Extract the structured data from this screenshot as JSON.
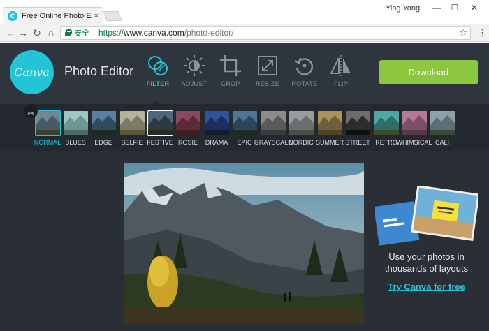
{
  "browser": {
    "tab_title": "Free Online Photo Editor",
    "tab_close": "×",
    "favicon_letter": "C",
    "user_name": "Ying Yong",
    "window_minimize": "—",
    "window_maximize": "☐",
    "window_close": "✕",
    "secure_label": "安全",
    "url_scheme": "https://",
    "url_host": "www.canva.com",
    "url_path": "/photo-editor/"
  },
  "app": {
    "logo_text": "Canva",
    "title": "Photo Editor",
    "download_label": "Download",
    "accent_color": "#23c4d6",
    "download_color": "#8dc63f",
    "tools": [
      {
        "label": "FILTER",
        "icon": "filter-icon",
        "active": true
      },
      {
        "label": "ADJUST",
        "icon": "adjust-icon",
        "active": false
      },
      {
        "label": "CROP",
        "icon": "crop-icon",
        "active": false
      },
      {
        "label": "RESIZE",
        "icon": "resize-icon",
        "active": false
      },
      {
        "label": "ROTATE",
        "icon": "rotate-icon",
        "active": false
      },
      {
        "label": "FLIP",
        "icon": "flip-icon",
        "active": false
      }
    ],
    "filters": [
      {
        "label": "NORMAL",
        "selected": true
      },
      {
        "label": "BLUES",
        "selected": false
      },
      {
        "label": "EDGE",
        "selected": false
      },
      {
        "label": "SELFIE",
        "selected": false
      },
      {
        "label": "FESTIVE",
        "selected": false
      },
      {
        "label": "ROSIE",
        "selected": false
      },
      {
        "label": "DRAMA",
        "selected": false
      },
      {
        "label": "EPIC",
        "selected": false
      },
      {
        "label": "GRAYSCALE",
        "selected": false
      },
      {
        "label": "NORDIC",
        "selected": false
      },
      {
        "label": "SUMMER",
        "selected": false
      },
      {
        "label": "STREET",
        "selected": false
      },
      {
        "label": "RETRO",
        "selected": false
      },
      {
        "label": "WHIMSICAL",
        "selected": false
      },
      {
        "label": "CALI",
        "selected": false
      }
    ],
    "promo": {
      "text_line1": "Use your photos in",
      "text_line2": "thousands of layouts",
      "link_label": "Try Canva for free"
    }
  }
}
